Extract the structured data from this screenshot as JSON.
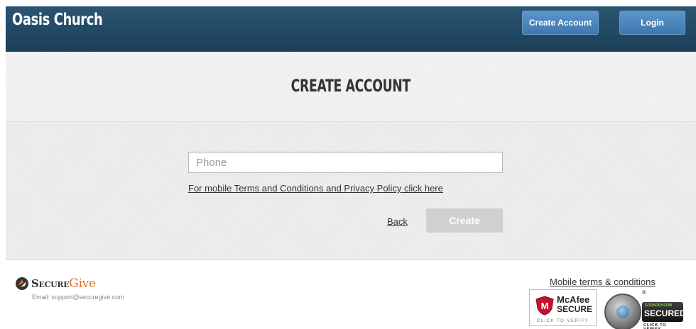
{
  "header": {
    "brand": "Oasis Church",
    "create_account_label": "Create Account",
    "login_label": "Login"
  },
  "title_band": {
    "title": "CREATE ACCOUNT"
  },
  "form": {
    "phone_placeholder": "Phone",
    "phone_value": "",
    "terms_link": "For mobile Terms and Conditions and Privacy Policy click here",
    "back_label": "Back",
    "create_label": "Create"
  },
  "footer": {
    "securegive_brand_secure": "Secure",
    "securegive_brand_give": "Give",
    "email": "Email: support@securegive.com",
    "mobile_terms": "Mobile terms & conditions",
    "mcafee": {
      "name": "McAfee",
      "secure": "SECURE",
      "verify": "CLICK TO VERIFY"
    },
    "godaddy": {
      "small": "GODADDY.COM",
      "secured": "SECURED",
      "verify": "CLICK TO VERIFY"
    }
  },
  "colors": {
    "header_bg": "#1f4560",
    "button_blue": "#4a86bd",
    "create_disabled": "#d0d0d0",
    "securegive_orange": "#e46a1f"
  }
}
